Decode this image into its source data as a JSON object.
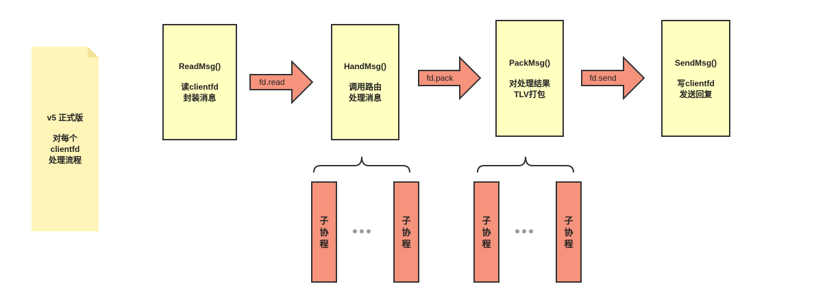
{
  "note": {
    "title": "v5 正式版",
    "lines": [
      "对每个",
      "clientfd",
      "处理流程"
    ],
    "color": "#fff5b8"
  },
  "stages": [
    {
      "fn": "ReadMsg()",
      "lines": [
        "读clientfd",
        "封装消息"
      ]
    },
    {
      "fn": "HandMsg()",
      "lines": [
        "调用路由",
        "处理消息"
      ]
    },
    {
      "fn": "PackMsg()",
      "lines": [
        "对处理结果",
        "TLV打包"
      ]
    },
    {
      "fn": "SendMsg()",
      "lines": [
        "写clientfd",
        "发送回复"
      ]
    }
  ],
  "arrows": [
    {
      "label": "fd.read"
    },
    {
      "label": "fd.pack"
    },
    {
      "label": "fd.send"
    }
  ],
  "coroutines": [
    {
      "label": "子协程"
    },
    {
      "label": "子协程"
    },
    {
      "label": "子协程"
    },
    {
      "label": "子协程"
    }
  ],
  "colors": {
    "stage_fill": "#ffffc0",
    "arrow_fill": "#f5937d",
    "coroutine_fill": "#f5937d",
    "outline": "#333333",
    "dots": "#999999"
  }
}
